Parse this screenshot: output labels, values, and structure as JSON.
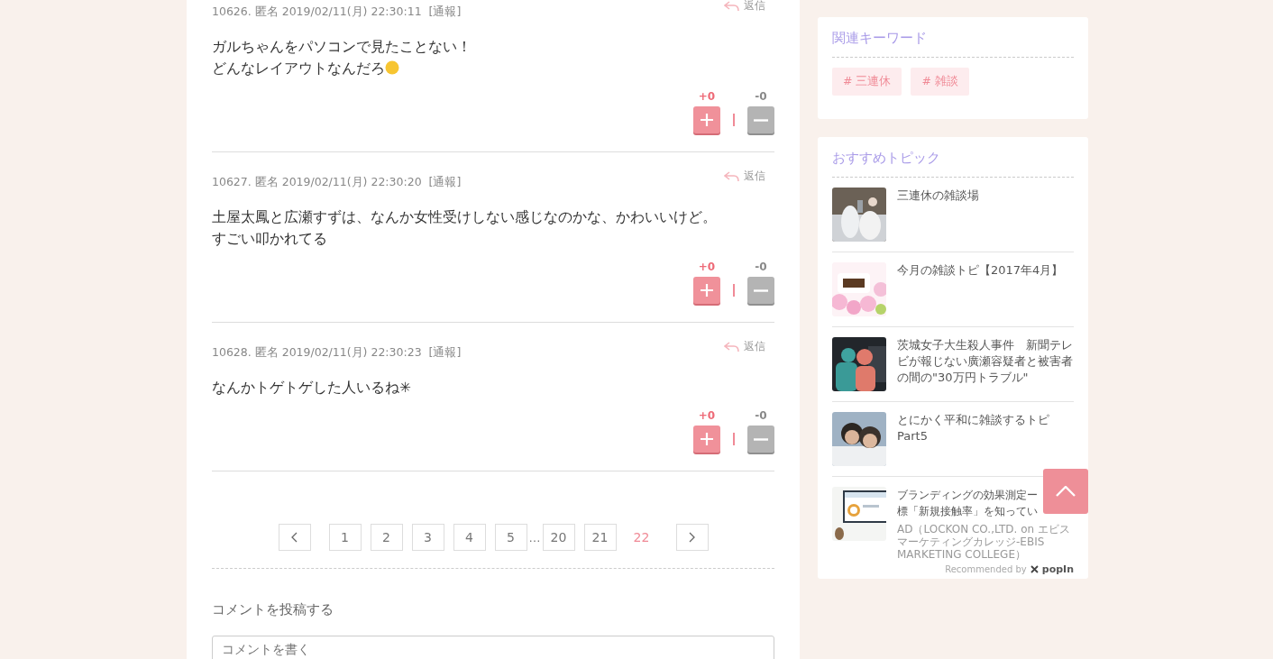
{
  "comments": [
    {
      "meta": "10626. 匿名 2019/02/11(月) 22:30:11",
      "report": "[通報]",
      "reply": "返信",
      "lines": [
        "ガルちゃんをパソコンで見たことない！",
        "どんなレイアウトなんだろ"
      ],
      "emoji": true,
      "plus": "+0",
      "minus": "-0"
    },
    {
      "meta": "10627. 匿名 2019/02/11(月) 22:30:20",
      "report": "[通報]",
      "reply": "返信",
      "lines": [
        "土屋太鳳と広瀬すずは、なんか女性受けしない感じなのかな、かわいいけど。",
        "すごい叩かれてる"
      ],
      "emoji": false,
      "plus": "+0",
      "minus": "-0"
    },
    {
      "meta": "10628. 匿名 2019/02/11(月) 22:30:23",
      "report": "[通報]",
      "reply": "返信",
      "lines": [
        "なんかトゲトゲした人いるね✳"
      ],
      "emoji": false,
      "plus": "+0",
      "minus": "-0"
    }
  ],
  "pagination": {
    "pages": [
      {
        "label": "1",
        "selected": false
      },
      {
        "label": "2",
        "selected": false
      },
      {
        "label": "3",
        "selected": false
      },
      {
        "label": "4",
        "selected": false
      },
      {
        "label": "5",
        "selected": false
      },
      {
        "label": "…",
        "kind": "gap"
      },
      {
        "label": "20",
        "selected": false
      },
      {
        "label": "21",
        "selected": false
      },
      {
        "label": "22",
        "selected": true
      }
    ]
  },
  "comment_form": {
    "heading": "コメントを投稿する",
    "placeholder": "コメントを書く"
  },
  "keywords": {
    "title": "関連キーワード",
    "tags": [
      "# 三連休",
      "# 雑談"
    ]
  },
  "recommended": {
    "title": "おすすめトピック",
    "items": [
      {
        "title": "三連休の雑談場"
      },
      {
        "title": "今月の雑談トピ【2017年4月】"
      },
      {
        "title": "茨城女子大生殺人事件　新聞テレビが報じない廣瀬容疑者と被害者の間の\"30万円トラブル\""
      },
      {
        "title": "とにかく平和に雑談するトピPart5"
      },
      {
        "title": "ブランディングの効果測定ー標「新規接触率」を知ってい",
        "ad": "AD（LOCKON CO.,LTD. on エビスマーケティングカレッジ-EBIS MARKETING COLLEGE）"
      }
    ],
    "credit": "Recommended by",
    "brand": "popIn"
  }
}
